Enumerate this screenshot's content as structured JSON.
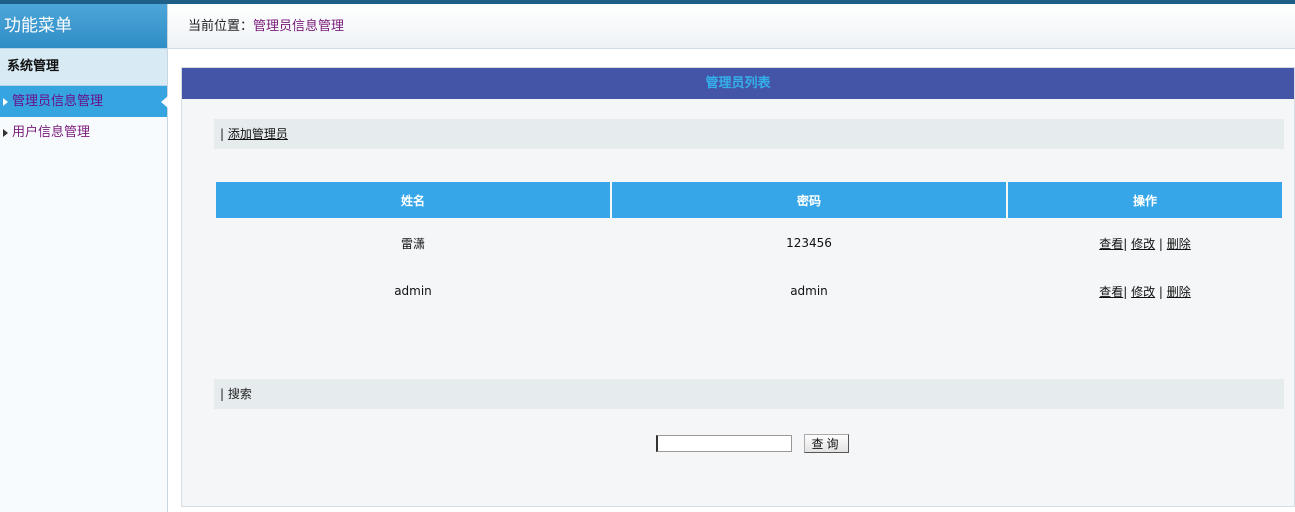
{
  "sidebar": {
    "title": "功能菜单",
    "section": "系统管理",
    "items": [
      {
        "label": "管理员信息管理"
      },
      {
        "label": "用户信息管理"
      }
    ]
  },
  "breadcrumb": {
    "prefix": "当前位置：",
    "current": "管理员信息管理"
  },
  "panel": {
    "title": "管理员列表",
    "add_prefix": "| ",
    "add_label": "添加管理员",
    "search_prefix": "| ",
    "search_label": "搜索"
  },
  "table": {
    "headers": [
      "姓名",
      "密码",
      "操作"
    ],
    "rows": [
      {
        "name": "雷潇",
        "password": "123456"
      },
      {
        "name": "admin",
        "password": "admin"
      }
    ],
    "actions": {
      "view": "查看",
      "edit": "修改",
      "delete": "删除",
      "sep": "|"
    }
  },
  "search": {
    "value": "",
    "button": "查询"
  },
  "colors": {
    "accent": "#36a6e8",
    "panel_title_bg": "#4455a8",
    "link_purple": "#7a1a7a"
  }
}
